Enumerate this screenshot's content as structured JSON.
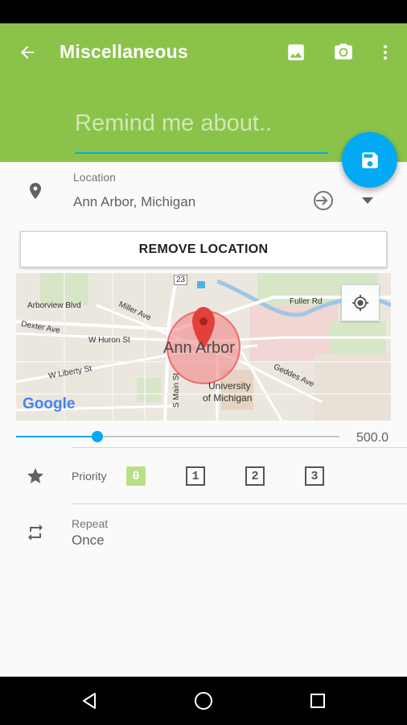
{
  "app_bar": {
    "title": "Miscellaneous",
    "icons": [
      "arrow-back-icon",
      "image-icon",
      "camera-icon",
      "more-vert-icon"
    ],
    "color": "#8bc34a"
  },
  "reminder": {
    "placeholder": "Remind me about..",
    "value": ""
  },
  "fab": {
    "icon": "save-icon",
    "color": "#03a9f4"
  },
  "location": {
    "label": "Location",
    "value": "Ann Arbor, Michigan",
    "icons": [
      "place-icon",
      "enter-icon",
      "dropdown-arrow-icon"
    ],
    "remove_button": "REMOVE LOCATION"
  },
  "map": {
    "center_label": "Ann Arbor",
    "logo": "Google",
    "labels": [
      "Arborview Blvd",
      "Miller Ave",
      "Dexter Ave",
      "W Huron St",
      "W Liberty St",
      "S Main St",
      "Fuller Rd",
      "Geddes Ave",
      "University",
      "of Michigan",
      "23"
    ]
  },
  "radius": {
    "value_text": "500.0",
    "fraction": 0.25
  },
  "priority": {
    "label": "Priority",
    "options": [
      "0",
      "1",
      "2",
      "3"
    ],
    "selected": "0",
    "selected_color": "#b9e089"
  },
  "repeat": {
    "label": "Repeat",
    "value": "Once"
  },
  "nav": {
    "icons": [
      "back-triangle-icon",
      "home-circle-icon",
      "recents-square-icon"
    ]
  }
}
